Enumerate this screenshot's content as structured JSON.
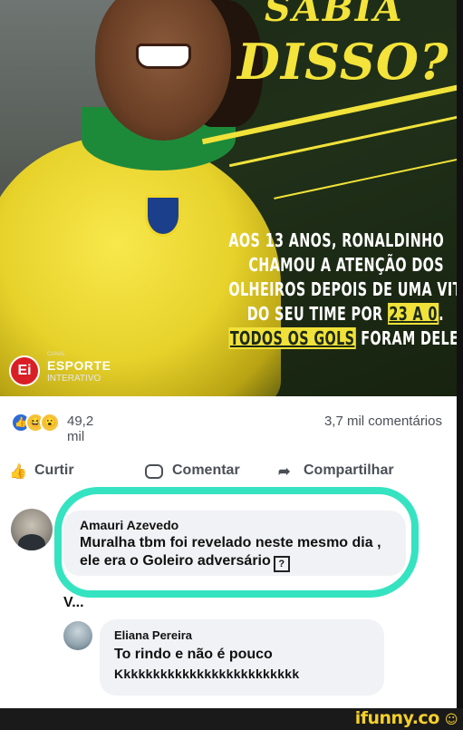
{
  "image": {
    "headline_line1": "SABIA",
    "headline_line2": "DISSO?",
    "caption": {
      "line1": "AOS 13 ANOS, RONALDINHO",
      "line2": "CHAMOU A ATENÇÃO DOS",
      "line3": "OLHEIROS DEPOIS DE UMA VITÓRIA",
      "line4_prefix": "DO SEU TIME POR ",
      "line4_highlight": "23 A 0",
      "line4_suffix": ".",
      "line5_highlight": "TODOS OS GOLS",
      "line5_suffix": " FORAM DELE"
    },
    "logo": {
      "canal": "CANAL",
      "esporte": "ESPORTE",
      "interativo": "INTERATIVO",
      "mark": "Ei"
    }
  },
  "post": {
    "reaction_count": "49,2 mil",
    "comment_count": "3,7 mil comentários",
    "actions": {
      "like": "Curtir",
      "comment": "Comentar",
      "share": "Compartilhar"
    }
  },
  "comments": [
    {
      "author": "Amauri Azevedo",
      "text": "Muralha tbm foi revelado neste mesmo dia , ele era o Goleiro adversário",
      "emoji": "?"
    },
    {
      "author": "Eliana Pereira",
      "text_line1": "To rindo e não é pouco",
      "text_line2": "Kkkkkkkkkkkkkkkkkkkkkkkkk"
    }
  ],
  "partial_text": "V...",
  "watermark": "ifunny.co",
  "colors": {
    "highlight_ring": "#35e3c1",
    "headline_yellow": "#f3e33a",
    "brand_red": "#d91f26",
    "fb_blue": "#2d6bd8",
    "watermark": "#f4cf2a"
  }
}
